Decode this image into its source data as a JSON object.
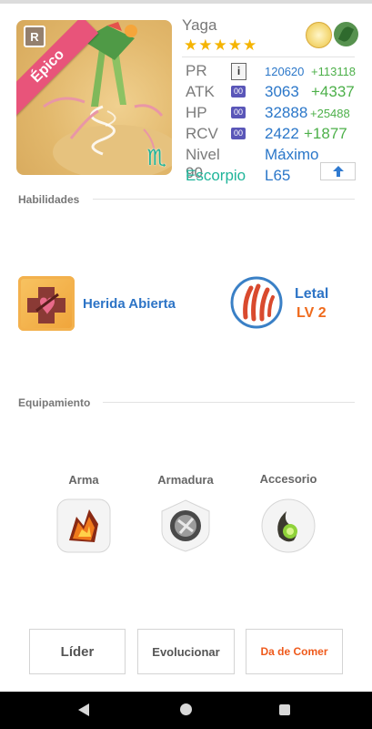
{
  "card": {
    "name": "Yaga",
    "rarity_label": "Épico",
    "rank_badge": "R",
    "stars": "★★★★★",
    "zodiac_symbol": "♏",
    "attributes": [
      "light-attribute-icon",
      "leaf-attribute-icon"
    ]
  },
  "stats": {
    "pr": {
      "label": "PR",
      "icon": "i",
      "base": "120620",
      "plus": "+113118"
    },
    "atk": {
      "label": "ATK",
      "icon": "00",
      "base": "3063",
      "plus": "+4337"
    },
    "hp": {
      "label": "HP",
      "icon": "00",
      "base": "32888",
      "plus": "+25488"
    },
    "rcv": {
      "label": "RCV",
      "icon": "00",
      "base": "2422",
      "plus": "+1877"
    },
    "level": {
      "label": "Nivel 90",
      "value": "Máximo"
    },
    "zodiac": {
      "label": "Escorpio",
      "value": "L65"
    }
  },
  "sections": {
    "skills_title": "Habilidades",
    "equipment_title": "Equipamiento"
  },
  "skills": {
    "active_name": "Herida Abierta",
    "leader_name": "Letal",
    "leader_level": "LV 2"
  },
  "equipment": {
    "weapon_label": "Arma",
    "armor_label": "Armadura",
    "accessory_label": "Accesorio"
  },
  "buttons": {
    "leader": "Líder",
    "evolve": "Evolucionar",
    "feed": "Da de Comer"
  },
  "colors": {
    "accent_blue": "#2d74c6",
    "bonus_green": "#4db04a",
    "feed_orange": "#ef5a1c",
    "epic_pink": "#e8547a"
  }
}
